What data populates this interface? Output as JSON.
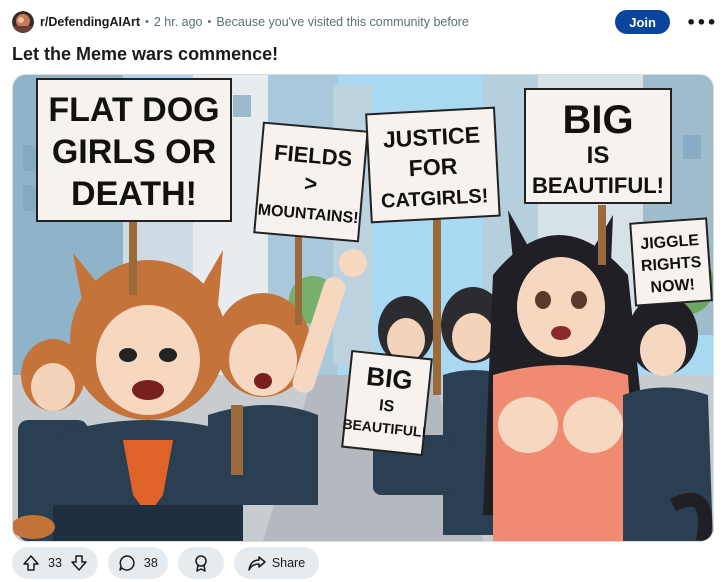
{
  "post": {
    "subreddit": "r/DefendingAIArt",
    "age": "2 hr. ago",
    "reason": "Because you've visited this community before",
    "join_label": "Join",
    "more_label": "•••",
    "title": "Let the Meme wars commence!"
  },
  "image": {
    "signs": {
      "flat_dog": [
        "FLAT DOG",
        "GIRLS OR",
        "DEATH!"
      ],
      "fields": [
        "FIELDS",
        ">",
        "MOUNTAINS!"
      ],
      "justice": [
        "JUSTICE",
        "FOR",
        "CATGIRLS!"
      ],
      "big_top": [
        "BIG",
        "IS",
        "BEAUTIFUL!"
      ],
      "jiggle": [
        "JIGGLE",
        "RIGHTS",
        "NOW!"
      ],
      "big_small": [
        "BIG",
        "IS",
        "BEAUTIFUL!"
      ]
    }
  },
  "actions": {
    "upvotes": "33",
    "comments": "38",
    "share_label": "Share"
  },
  "icons": [
    "upvote-icon",
    "downvote-icon",
    "comment-icon",
    "award-icon",
    "share-icon",
    "more-icon"
  ],
  "colors": {
    "join": "#0a449b",
    "pill": "#e5ebee",
    "muted": "#576f76"
  }
}
